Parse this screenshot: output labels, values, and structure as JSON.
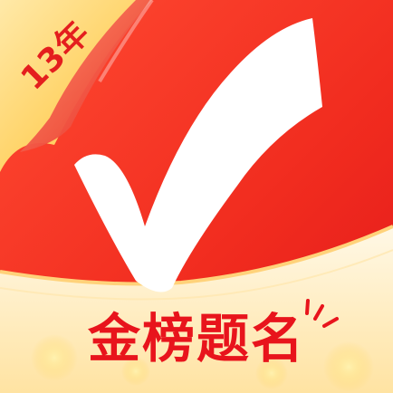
{
  "app_icon": {
    "badge_text": "13年",
    "slogan_text": "金榜题名",
    "logo": "checkmark-logo",
    "colors": {
      "red": "#ef2a1c",
      "red_dark": "#e11b17",
      "gold": "#ffd670",
      "cream": "#fff6da",
      "white": "#ffffff"
    }
  }
}
